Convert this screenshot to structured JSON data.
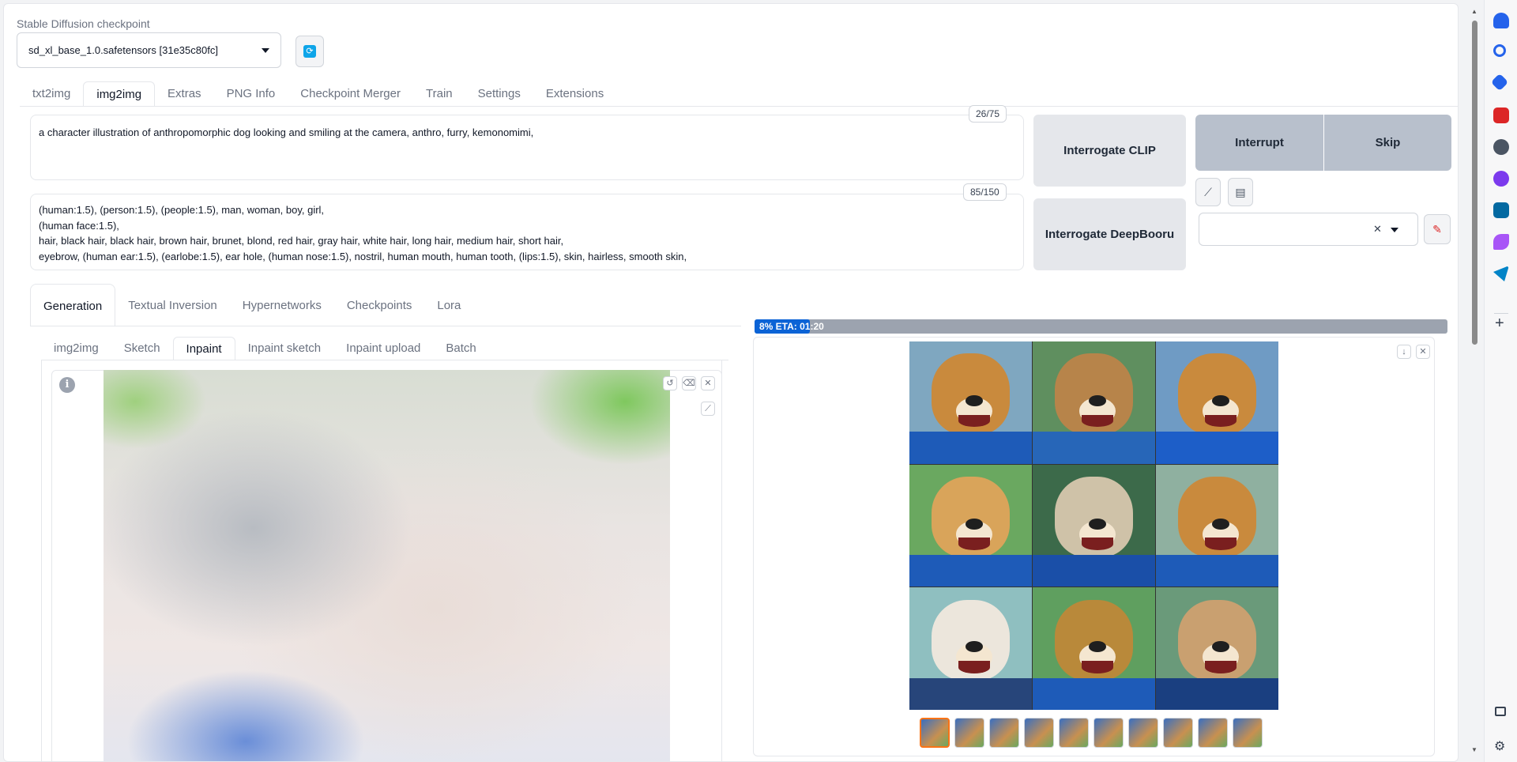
{
  "checkpoint": {
    "label": "Stable Diffusion checkpoint",
    "value": "sd_xl_base_1.0.safetensors [31e35c80fc]"
  },
  "tabs": [
    "txt2img",
    "img2img",
    "Extras",
    "PNG Info",
    "Checkpoint Merger",
    "Train",
    "Settings",
    "Extensions"
  ],
  "prompt": {
    "text": "a character illustration of anthropomorphic dog looking and smiling at the camera, anthro, furry, kemonomimi,",
    "counter": "26/75"
  },
  "negative": {
    "text": "(human:1.5), (person:1.5), (people:1.5), man, woman, boy, girl,\n(human face:1.5),\nhair, black hair, black hair, brown hair, brunet, blond, red hair, gray hair, white hair, long hair, medium hair, short hair,\neyebrow, (human ear:1.5), (earlobe:1.5), ear hole, (human nose:1.5), nostril, human mouth, human tooth, (lips:1.5), skin, hairless, smooth skin,",
    "counter": "85/150"
  },
  "buttons": {
    "interrogate_clip": "Interrogate CLIP",
    "interrogate_deepbooru": "Interrogate DeepBooru",
    "interrupt": "Interrupt",
    "skip": "Skip"
  },
  "gen_tabs": [
    "Generation",
    "Textual Inversion",
    "Hypernetworks",
    "Checkpoints",
    "Lora"
  ],
  "sub_tabs": [
    "img2img",
    "Sketch",
    "Inpaint",
    "Inpaint sketch",
    "Inpaint upload",
    "Batch"
  ],
  "progress": {
    "text": "8% ETA: 01:20",
    "fraction": 0.08
  },
  "colors": {
    "accent": "#0b63d6",
    "thumb_selected": "#f97316",
    "interrupt_bg": "#b8c0cc"
  },
  "thumb_count": 10,
  "icons": {
    "refresh": "refresh-icon",
    "info": "info-icon",
    "close": "close-icon",
    "download": "download-icon"
  }
}
